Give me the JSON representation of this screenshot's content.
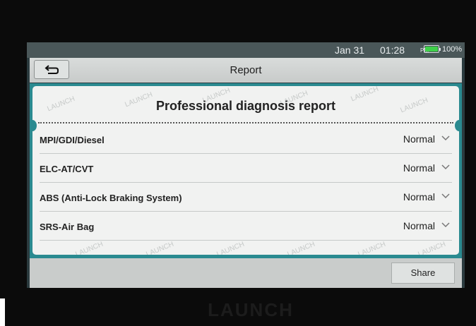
{
  "statusbar": {
    "date": "Jan 31",
    "time": "01:28",
    "ampm": "PM",
    "battery_label": "100%",
    "battery_level_percent": 100,
    "battery_color": "#3fd04a"
  },
  "header": {
    "back_icon": "back-arrow-icon",
    "title": "Report"
  },
  "report": {
    "title": "Professional diagnosis report",
    "watermark": "LAUNCH",
    "rows": [
      {
        "name": "MPI/GDI/Diesel",
        "status": "Normal"
      },
      {
        "name": "ELC-AT/CVT",
        "status": "Normal"
      },
      {
        "name": "ABS (Anti-Lock Braking System)",
        "status": "Normal"
      },
      {
        "name": "SRS-Air Bag",
        "status": "Normal"
      }
    ]
  },
  "footer": {
    "share_label": "Share"
  },
  "device": {
    "brand": "LAUNCH"
  },
  "colors": {
    "frame_teal": "#2a8a90",
    "card_bg": "#f1f2f1"
  }
}
